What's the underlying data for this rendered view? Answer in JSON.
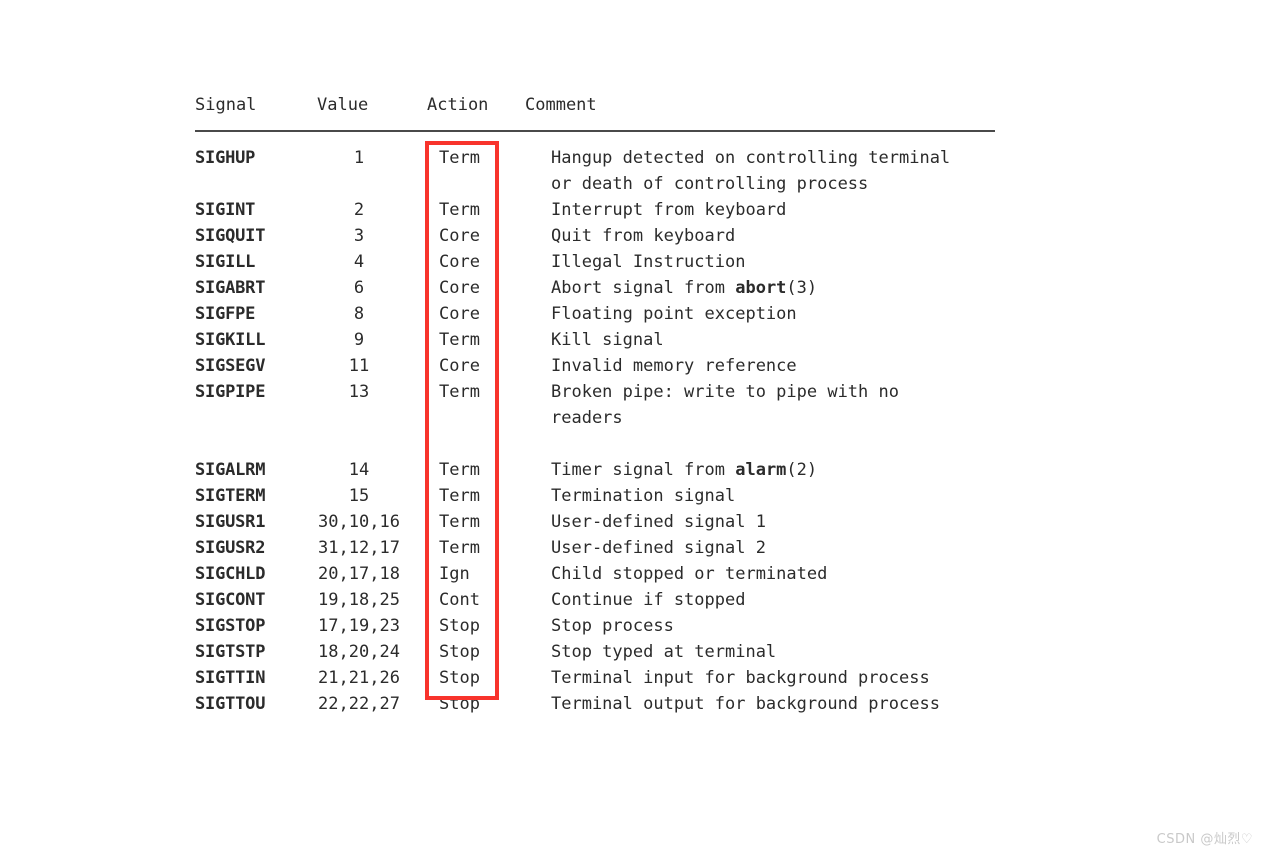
{
  "document": {
    "kind": "man-page-signal-table",
    "columns": [
      "Signal",
      "Value",
      "Action",
      "Comment"
    ],
    "groups": [
      {
        "rows": [
          {
            "signal": "SIGHUP",
            "value": "1",
            "action": "Term",
            "comment": "Hangup detected on controlling terminal",
            "comment_cont": "or death of controlling process"
          },
          {
            "signal": "SIGINT",
            "value": "2",
            "action": "Term",
            "comment": "Interrupt from keyboard"
          },
          {
            "signal": "SIGQUIT",
            "value": "3",
            "action": "Core",
            "comment": "Quit from keyboard"
          },
          {
            "signal": "SIGILL",
            "value": "4",
            "action": "Core",
            "comment": "Illegal Instruction"
          },
          {
            "signal": "SIGABRT",
            "value": "6",
            "action": "Core",
            "comment": "Abort signal from ",
            "comment_bold": "abort",
            "comment_tail": "(3)"
          },
          {
            "signal": "SIGFPE",
            "value": "8",
            "action": "Core",
            "comment": "Floating point exception"
          },
          {
            "signal": "SIGKILL",
            "value": "9",
            "action": "Term",
            "comment": "Kill signal"
          },
          {
            "signal": "SIGSEGV",
            "value": "11",
            "action": "Core",
            "comment": "Invalid memory reference"
          },
          {
            "signal": "SIGPIPE",
            "value": "13",
            "action": "Term",
            "comment": "Broken pipe: write to pipe with no",
            "comment_cont": "readers"
          }
        ]
      },
      {
        "rows": [
          {
            "signal": "SIGALRM",
            "value": "14",
            "action": "Term",
            "comment": "Timer signal from ",
            "comment_bold": "alarm",
            "comment_tail": "(2)"
          },
          {
            "signal": "SIGTERM",
            "value": "15",
            "action": "Term",
            "comment": "Termination signal"
          },
          {
            "signal": "SIGUSR1",
            "value": "30,10,16",
            "action": "Term",
            "comment": "User-defined signal 1"
          },
          {
            "signal": "SIGUSR2",
            "value": "31,12,17",
            "action": "Term",
            "comment": "User-defined signal 2"
          },
          {
            "signal": "SIGCHLD",
            "value": "20,17,18",
            "action": "Ign",
            "comment": "Child stopped or terminated"
          },
          {
            "signal": "SIGCONT",
            "value": "19,18,25",
            "action": "Cont",
            "comment": "Continue if stopped"
          },
          {
            "signal": "SIGSTOP",
            "value": "17,19,23",
            "action": "Stop",
            "comment": "Stop process"
          },
          {
            "signal": "SIGTSTP",
            "value": "18,20,24",
            "action": "Stop",
            "comment": "Stop typed at terminal"
          },
          {
            "signal": "SIGTTIN",
            "value": "21,21,26",
            "action": "Stop",
            "comment": "Terminal input for background process"
          },
          {
            "signal": "SIGTTOU",
            "value": "22,22,27",
            "action": "Stop",
            "comment": "Terminal output for background process"
          }
        ]
      }
    ]
  },
  "annotation": {
    "action_column_highlight_color": "#f8332c"
  },
  "watermark": {
    "text": "CSDN @灿烈♡"
  },
  "colors": {
    "background": "#ffffff",
    "text": "#2b2b2b",
    "rule": "#4a4a4a",
    "highlight": "#f8332c",
    "watermark": "#c9c9c9"
  }
}
